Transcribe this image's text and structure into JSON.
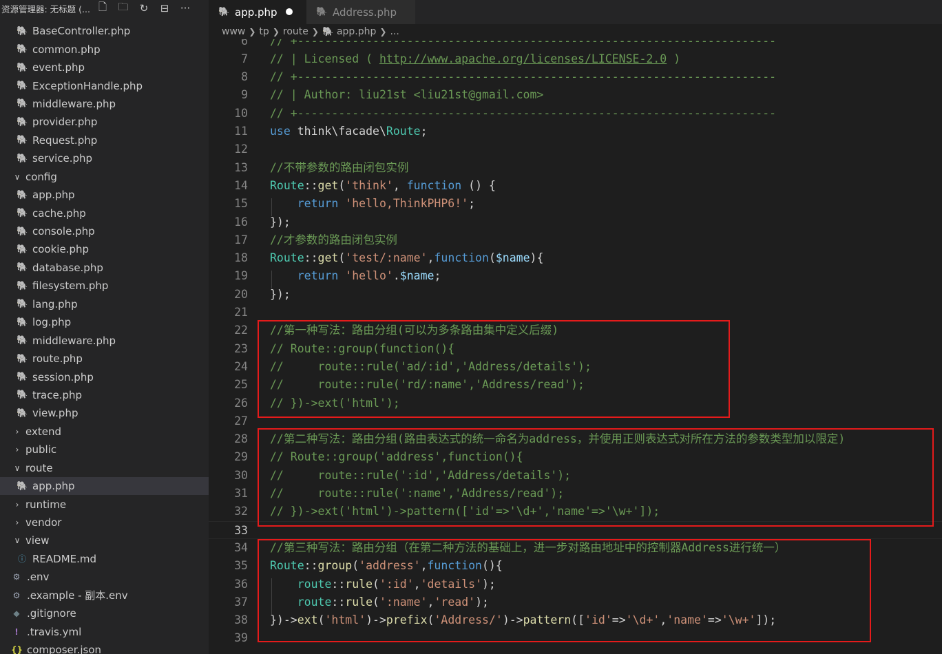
{
  "explorer": {
    "title": "资源管理器: 无标题 (...",
    "actions": [
      {
        "icon": "new-file-icon",
        "glyph": "🗋"
      },
      {
        "icon": "new-folder-icon",
        "glyph": "🗀"
      },
      {
        "icon": "refresh-icon",
        "glyph": "↻"
      },
      {
        "icon": "collapse-all-icon",
        "glyph": "⊟"
      },
      {
        "icon": "more-icon",
        "glyph": "···"
      }
    ],
    "tree": [
      {
        "label": "BaseController.php",
        "type": "php",
        "depth": 2
      },
      {
        "label": "common.php",
        "type": "php",
        "depth": 2
      },
      {
        "label": "event.php",
        "type": "php",
        "depth": 2
      },
      {
        "label": "ExceptionHandle.php",
        "type": "php",
        "depth": 2
      },
      {
        "label": "middleware.php",
        "type": "php",
        "depth": 2
      },
      {
        "label": "provider.php",
        "type": "php",
        "depth": 2
      },
      {
        "label": "Request.php",
        "type": "php",
        "depth": 2
      },
      {
        "label": "service.php",
        "type": "php",
        "depth": 2
      },
      {
        "label": "config",
        "type": "folder-open",
        "depth": 1
      },
      {
        "label": "app.php",
        "type": "php",
        "depth": 2
      },
      {
        "label": "cache.php",
        "type": "php",
        "depth": 2
      },
      {
        "label": "console.php",
        "type": "php",
        "depth": 2
      },
      {
        "label": "cookie.php",
        "type": "php",
        "depth": 2
      },
      {
        "label": "database.php",
        "type": "php",
        "depth": 2
      },
      {
        "label": "filesystem.php",
        "type": "php",
        "depth": 2
      },
      {
        "label": "lang.php",
        "type": "php",
        "depth": 2
      },
      {
        "label": "log.php",
        "type": "php",
        "depth": 2
      },
      {
        "label": "middleware.php",
        "type": "php",
        "depth": 2
      },
      {
        "label": "route.php",
        "type": "php",
        "depth": 2
      },
      {
        "label": "session.php",
        "type": "php",
        "depth": 2
      },
      {
        "label": "trace.php",
        "type": "php",
        "depth": 2
      },
      {
        "label": "view.php",
        "type": "php",
        "depth": 2
      },
      {
        "label": "extend",
        "type": "folder-closed",
        "depth": 1
      },
      {
        "label": "public",
        "type": "folder-closed",
        "depth": 1
      },
      {
        "label": "route",
        "type": "folder-open",
        "depth": 1
      },
      {
        "label": "app.php",
        "type": "php",
        "depth": 2,
        "selected": true
      },
      {
        "label": "runtime",
        "type": "folder-closed",
        "depth": 1
      },
      {
        "label": "vendor",
        "type": "folder-closed",
        "depth": 1
      },
      {
        "label": "view",
        "type": "folder-open",
        "depth": 1
      },
      {
        "label": "README.md",
        "type": "info",
        "depth": 2
      },
      {
        "label": ".env",
        "type": "gear",
        "depth": 1
      },
      {
        "label": ".example - 副本.env",
        "type": "gear",
        "depth": 1
      },
      {
        "label": ".gitignore",
        "type": "git",
        "depth": 1
      },
      {
        "label": ".travis.yml",
        "type": "yml",
        "depth": 1
      },
      {
        "label": "composer.json",
        "type": "json",
        "depth": 1
      }
    ]
  },
  "tabs": [
    {
      "label": "app.php",
      "active": true,
      "modified": true
    },
    {
      "label": "Address.php",
      "active": false
    }
  ],
  "breadcrumb": [
    "www",
    "tp",
    "route",
    "app.php",
    "..."
  ],
  "colors": {
    "comment": "#6a9955",
    "keyword": "#569cd6",
    "class": "#4ec9b0",
    "function": "#dcdcaa",
    "string": "#ce9178",
    "variable": "#9cdcfe",
    "default": "#d4d4d4",
    "highlight_box": "#e51b1b"
  },
  "code": [
    {
      "n": "6",
      "t": [
        [
          "comment",
          "// +----------------------------------------------------------------------"
        ]
      ]
    },
    {
      "n": "7",
      "t": [
        [
          "comment",
          "// | Licensed ( "
        ],
        [
          "link",
          "http://www.apache.org/licenses/LICENSE-2.0"
        ],
        [
          "comment",
          " )"
        ]
      ]
    },
    {
      "n": "8",
      "t": [
        [
          "comment",
          "// +----------------------------------------------------------------------"
        ]
      ]
    },
    {
      "n": "9",
      "t": [
        [
          "comment",
          "// | Author: liu21st <liu21st@gmail.com>"
        ]
      ]
    },
    {
      "n": "10",
      "t": [
        [
          "comment",
          "// +----------------------------------------------------------------------"
        ]
      ]
    },
    {
      "n": "11",
      "t": [
        [
          "keyword",
          "use"
        ],
        [
          "default",
          " think\\facade\\"
        ],
        [
          "class",
          "Route"
        ],
        [
          "default",
          ";"
        ]
      ]
    },
    {
      "n": "12",
      "t": []
    },
    {
      "n": "13",
      "t": [
        [
          "comment",
          "//不带参数的路由闭包实例"
        ]
      ]
    },
    {
      "n": "14",
      "t": [
        [
          "class",
          "Route"
        ],
        [
          "default",
          "::"
        ],
        [
          "function",
          "get"
        ],
        [
          "default",
          "("
        ],
        [
          "string",
          "'think'"
        ],
        [
          "default",
          ", "
        ],
        [
          "keyword",
          "function"
        ],
        [
          "default",
          " () {"
        ]
      ]
    },
    {
      "n": "15",
      "t": [
        [
          "default",
          "    "
        ],
        [
          "keyword",
          "return"
        ],
        [
          "default",
          " "
        ],
        [
          "string",
          "'hello,ThinkPHP6!'"
        ],
        [
          "default",
          ";"
        ]
      ]
    },
    {
      "n": "16",
      "t": [
        [
          "default",
          "});"
        ]
      ]
    },
    {
      "n": "17",
      "t": [
        [
          "comment",
          "//才参数的路由闭包实例"
        ]
      ]
    },
    {
      "n": "18",
      "t": [
        [
          "class",
          "Route"
        ],
        [
          "default",
          "::"
        ],
        [
          "function",
          "get"
        ],
        [
          "default",
          "("
        ],
        [
          "string",
          "'test/:name'"
        ],
        [
          "default",
          ","
        ],
        [
          "keyword",
          "function"
        ],
        [
          "default",
          "("
        ],
        [
          "variable",
          "$name"
        ],
        [
          "default",
          "){"
        ]
      ]
    },
    {
      "n": "19",
      "t": [
        [
          "default",
          "    "
        ],
        [
          "keyword",
          "return"
        ],
        [
          "default",
          " "
        ],
        [
          "string",
          "'hello'"
        ],
        [
          "default",
          "."
        ],
        [
          "variable",
          "$name"
        ],
        [
          "default",
          ";"
        ]
      ]
    },
    {
      "n": "20",
      "t": [
        [
          "default",
          "});"
        ]
      ]
    },
    {
      "n": "21",
      "t": []
    },
    {
      "n": "22",
      "t": [
        [
          "comment",
          "//第一种写法：路由分组(可以为多条路由集中定义后缀)"
        ]
      ]
    },
    {
      "n": "23",
      "t": [
        [
          "comment",
          "// Route::group(function(){"
        ]
      ]
    },
    {
      "n": "24",
      "t": [
        [
          "comment",
          "//     route::rule('ad/:id','Address/details');"
        ]
      ]
    },
    {
      "n": "25",
      "t": [
        [
          "comment",
          "//     route::rule('rd/:name','Address/read');"
        ]
      ]
    },
    {
      "n": "26",
      "t": [
        [
          "comment",
          "// })->ext('html');"
        ]
      ]
    },
    {
      "n": "27",
      "t": []
    },
    {
      "n": "28",
      "t": [
        [
          "comment",
          "//第二种写法：路由分组(路由表达式的统一命名为address，并使用正则表达式对所在方法的参数类型加以限定)"
        ]
      ]
    },
    {
      "n": "29",
      "t": [
        [
          "comment",
          "// Route::group('address',function(){"
        ]
      ]
    },
    {
      "n": "30",
      "t": [
        [
          "comment",
          "//     route::rule(':id','Address/details');"
        ]
      ]
    },
    {
      "n": "31",
      "t": [
        [
          "comment",
          "//     route::rule(':name','Address/read');"
        ]
      ]
    },
    {
      "n": "32",
      "t": [
        [
          "comment",
          "// })->ext('html')->pattern(['id'=>'\\d+','name'=>'\\w+']);"
        ]
      ]
    },
    {
      "n": "33",
      "t": [],
      "current": true
    },
    {
      "n": "34",
      "t": [
        [
          "comment",
          "//第三种写法：路由分组（在第二种方法的基础上，进一步对路由地址中的控制器Address进行统一）"
        ]
      ]
    },
    {
      "n": "35",
      "t": [
        [
          "class",
          "Route"
        ],
        [
          "default",
          "::"
        ],
        [
          "function",
          "group"
        ],
        [
          "default",
          "("
        ],
        [
          "string",
          "'address'"
        ],
        [
          "default",
          ","
        ],
        [
          "keyword",
          "function"
        ],
        [
          "default",
          "(){"
        ]
      ]
    },
    {
      "n": "36",
      "t": [
        [
          "default",
          "    "
        ],
        [
          "class",
          "route"
        ],
        [
          "default",
          "::"
        ],
        [
          "function",
          "rule"
        ],
        [
          "default",
          "("
        ],
        [
          "string",
          "':id'"
        ],
        [
          "default",
          ","
        ],
        [
          "string",
          "'details'"
        ],
        [
          "default",
          ");"
        ]
      ]
    },
    {
      "n": "37",
      "t": [
        [
          "default",
          "    "
        ],
        [
          "class",
          "route"
        ],
        [
          "default",
          "::"
        ],
        [
          "function",
          "rule"
        ],
        [
          "default",
          "("
        ],
        [
          "string",
          "':name'"
        ],
        [
          "default",
          ","
        ],
        [
          "string",
          "'read'"
        ],
        [
          "default",
          ");"
        ]
      ]
    },
    {
      "n": "38",
      "t": [
        [
          "default",
          "})->"
        ],
        [
          "function",
          "ext"
        ],
        [
          "default",
          "("
        ],
        [
          "string",
          "'html'"
        ],
        [
          "default",
          ")->"
        ],
        [
          "function",
          "prefix"
        ],
        [
          "default",
          "("
        ],
        [
          "string",
          "'Address/'"
        ],
        [
          "default",
          ")->"
        ],
        [
          "function",
          "pattern"
        ],
        [
          "default",
          "(["
        ],
        [
          "string",
          "'id'"
        ],
        [
          "default",
          "=>"
        ],
        [
          "string",
          "'\\d+'"
        ],
        [
          "default",
          ","
        ],
        [
          "string",
          "'name'"
        ],
        [
          "default",
          "=>"
        ],
        [
          "string",
          "'\\w+'"
        ],
        [
          "default",
          "]);"
        ]
      ]
    },
    {
      "n": "39",
      "t": []
    }
  ]
}
